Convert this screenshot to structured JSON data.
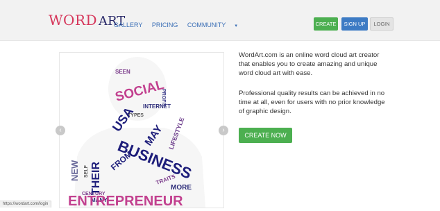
{
  "brand": {
    "logo_word": "WORD",
    "logo_art": "ART"
  },
  "nav": {
    "links": [
      "GALLERY",
      "PRICING",
      "COMMUNITY"
    ],
    "buttons": {
      "create": "CREATE",
      "signup": "SIGN UP",
      "login": "LOGIN"
    }
  },
  "hero": {
    "paragraph1": "WordArt.com is an online word cloud art creator that enables you to create amazing and unique word cloud art with ease.",
    "paragraph2": "Professional quality results can be achieved in no time at all, even for users with no prior knowledge of graphic design.",
    "cta_label": "CREATE NOW"
  },
  "carousel": {
    "words": {
      "social": "SOCIAL",
      "usa": "USA",
      "business": "BUSINESS",
      "entrepreneur": "ENTREPRENEUR",
      "their": "THEIR",
      "from": "FROM",
      "may": "MAY",
      "internet": "INTERNET",
      "lifestyle": "LIFESTYLE",
      "more": "MORE",
      "traits": "TRAITS",
      "profit": "PROFIT",
      "types": "TYPES",
      "new": "NEW",
      "self": "SELF",
      "century": "CENTURY",
      "many": "MANY",
      "seen": "SEEN"
    }
  },
  "status_bar": {
    "url": "https://wordart.com/login"
  },
  "colors": {
    "green": "#4caf50",
    "blue": "#3d7bc4",
    "logo_pink": "#d6375b",
    "navy": "#1d1d7a"
  }
}
